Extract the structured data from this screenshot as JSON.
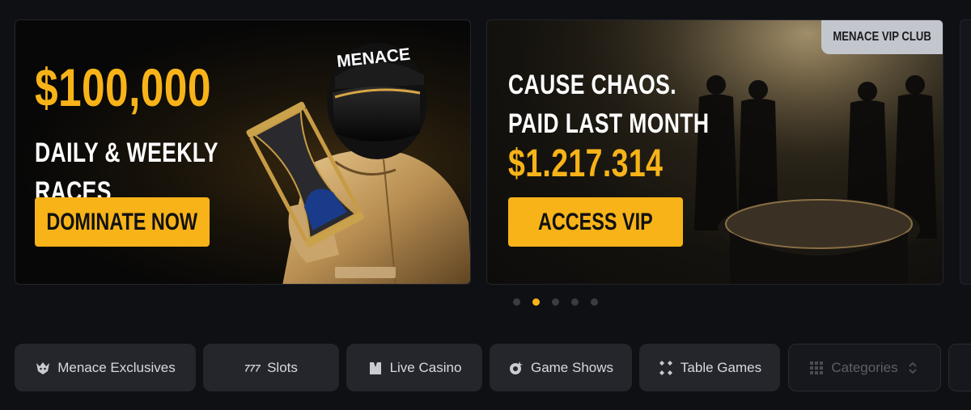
{
  "banners": [
    {
      "amount": "$100,000",
      "line1": "DAILY & WEEKLY",
      "line2": "RACES",
      "cta": "DOMINATE NOW",
      "helmet_text": "MENACE"
    },
    {
      "tag": "MENACE VIP CLUB",
      "line1": "CAUSE CHAOS.",
      "line2": "PAID LAST MONTH",
      "amount": "$1.217.314",
      "cta": "ACCESS VIP"
    }
  ],
  "carousel": {
    "total": 5,
    "active_index": 1
  },
  "categories": [
    {
      "label": "Menace Exclusives",
      "icon": "menace-logo-icon"
    },
    {
      "label": "Slots",
      "icon": "slots-777-icon"
    },
    {
      "label": "Live Casino",
      "icon": "dealer-icon"
    },
    {
      "label": "Game Shows",
      "icon": "game-show-icon"
    },
    {
      "label": "Table Games",
      "icon": "dice-icon"
    },
    {
      "label": "Categories",
      "icon": "grid-icon",
      "trailing_icon": "chevron-updown-icon"
    }
  ],
  "colors": {
    "accent": "#f7b318",
    "background": "#0f1014",
    "chip": "#25262c"
  }
}
